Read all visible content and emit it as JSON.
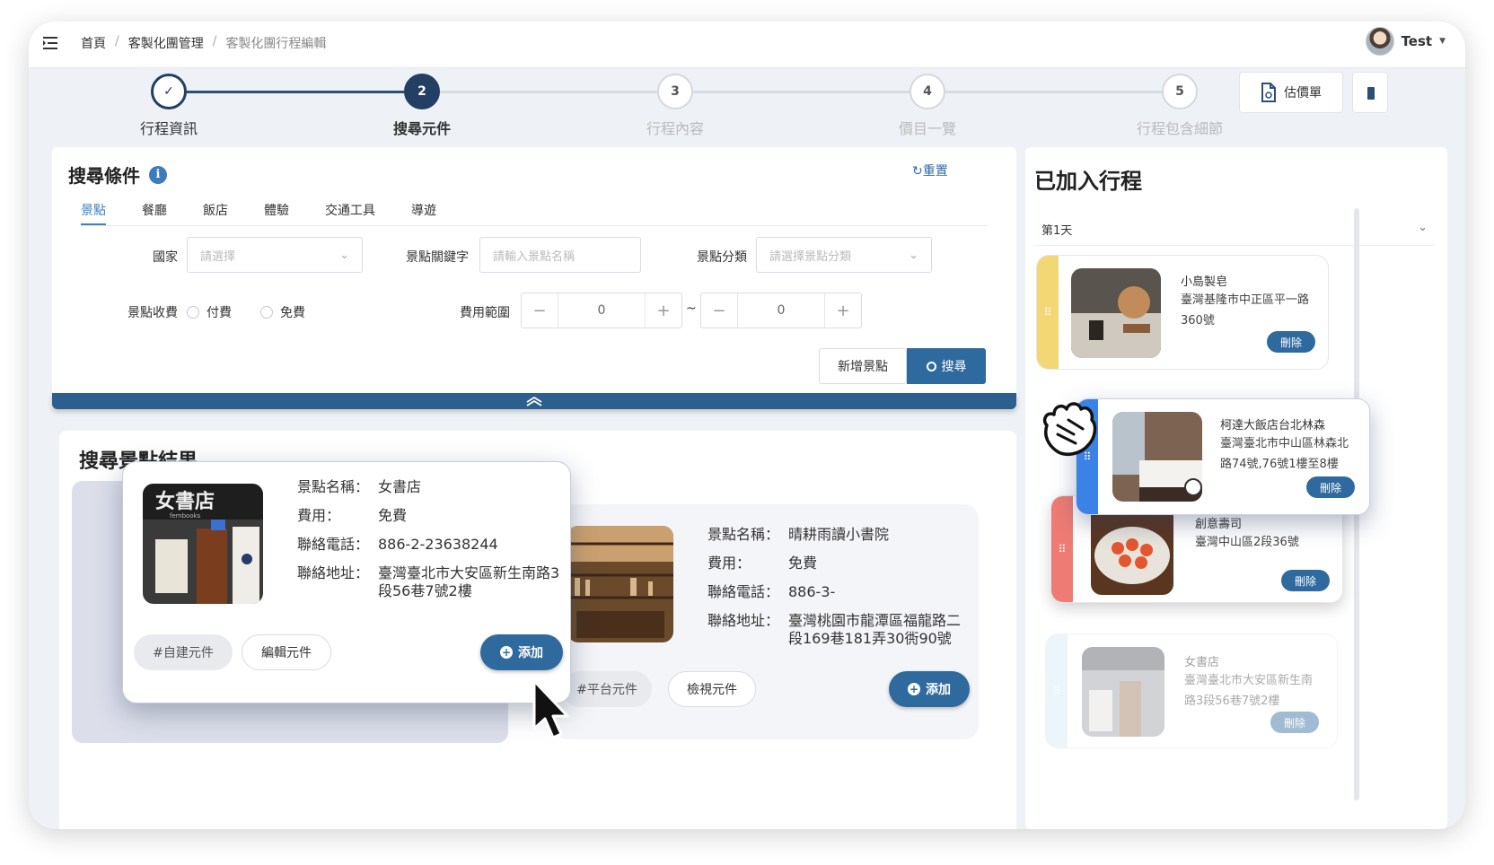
{
  "header": {
    "breadcrumb": [
      "首頁",
      "客製化團管理",
      "客製化團行程編輯"
    ],
    "user_name": "Test"
  },
  "steps": [
    {
      "num": "✓",
      "label": "行程資訊",
      "state": "done"
    },
    {
      "num": "2",
      "label": "搜尋元件",
      "state": "active"
    },
    {
      "num": "3",
      "label": "行程內容",
      "state": "todo"
    },
    {
      "num": "4",
      "label": "價目一覽",
      "state": "todo"
    },
    {
      "num": "5",
      "label": "行程包含細節",
      "state": "todo"
    }
  ],
  "quote_button": "估價單",
  "search": {
    "title": "搜尋條件",
    "reset": "重置",
    "tabs": [
      "景點",
      "餐廳",
      "飯店",
      "體驗",
      "交通工具",
      "導遊"
    ],
    "country_label": "國家",
    "country_placeholder": "請選擇",
    "keyword_label": "景點關鍵字",
    "keyword_placeholder": "請輸入景點名稱",
    "category_label": "景點分類",
    "category_placeholder": "請選擇景點分類",
    "fee_label": "景點收費",
    "fee_options": [
      "付費",
      "免費"
    ],
    "range_label": "費用範圍",
    "range_min": "0",
    "range_max": "0",
    "range_sep": "~",
    "add_spot": "新增景點",
    "search_button": "搜尋"
  },
  "results": {
    "title": "搜尋景點結果",
    "field_labels": {
      "name": "景點名稱：",
      "fee": "費用：",
      "phone": "聯絡電話：",
      "address": "聯絡地址："
    },
    "items": [
      {
        "name": "女書店",
        "fee": "免費",
        "phone": "886-2-23638244",
        "address": "臺灣臺北市大安區新生南路3段56巷7號2樓",
        "tag": "#自建元件",
        "action": "編輯元件",
        "add": "添加",
        "sign_text": "女書店",
        "sign_sub": "fembooks"
      },
      {
        "name": "晴耕雨讀小書院",
        "fee": "免費",
        "phone": "886-3-",
        "address": "臺灣桃園市龍潭區福龍路二段169巷181弄30衖90號",
        "tag": "#平台元件",
        "action": "檢視元件",
        "add": "添加"
      }
    ]
  },
  "itinerary": {
    "title": "已加入行程",
    "day": "第1天",
    "delete_label": "刪除",
    "items": [
      {
        "name": "小島製皂",
        "address": "臺灣基隆市中正區平一路360號",
        "color": "#f3d774"
      },
      {
        "name": "柯達大飯店台北林森",
        "address": "臺灣臺北市中山區林森北路74號,76號1樓至8樓",
        "color": "#3b82e6"
      },
      {
        "name": "創意壽司",
        "address": "臺灣中山區2段36號",
        "color": "#ee7c74"
      },
      {
        "name": "女書店",
        "address": "臺灣臺北市大安區新生南路3段56巷7號2樓",
        "color": "#d6ecf6"
      }
    ]
  }
}
